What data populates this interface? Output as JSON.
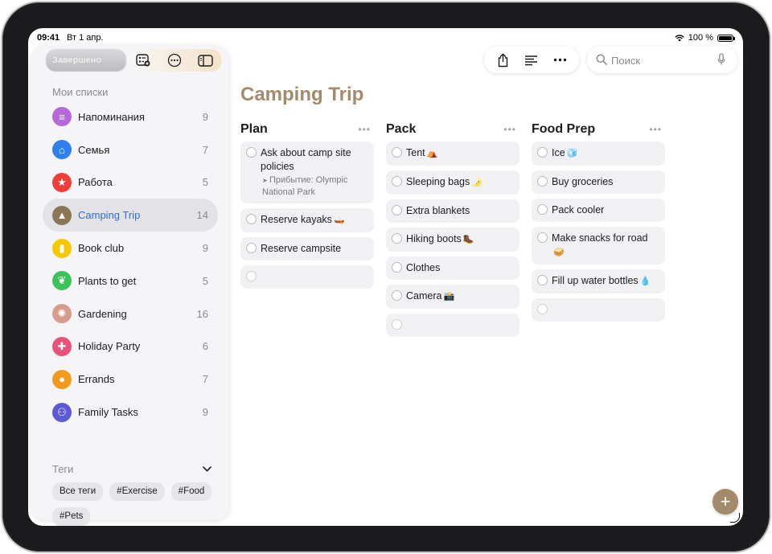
{
  "status": {
    "time": "09:41",
    "date": "Вт 1 апр.",
    "battery": "100 %"
  },
  "sidebar": {
    "top_pill": "Завершено",
    "section_title": "Мои списки",
    "lists": [
      {
        "label": "Напоминания",
        "count": "9",
        "color": "#b36ad6",
        "icon": "list-icon",
        "glyph": "≡"
      },
      {
        "label": "Семья",
        "count": "7",
        "color": "#2f80ed",
        "icon": "house-icon",
        "glyph": "⌂"
      },
      {
        "label": "Работа",
        "count": "5",
        "color": "#ef3e3a",
        "icon": "star-icon",
        "glyph": "★"
      },
      {
        "label": "Camping Trip",
        "count": "14",
        "color": "#8c7656",
        "icon": "tent-icon",
        "glyph": "▲",
        "selected": true
      },
      {
        "label": "Book club",
        "count": "9",
        "color": "#f6c800",
        "icon": "bookmark-icon",
        "glyph": "▮"
      },
      {
        "label": "Plants to get",
        "count": "5",
        "color": "#3cc45a",
        "icon": "leaf-icon",
        "glyph": "❦"
      },
      {
        "label": "Gardening",
        "count": "16",
        "color": "#d79c8e",
        "icon": "sun-icon",
        "glyph": "✺"
      },
      {
        "label": "Holiday Party",
        "count": "6",
        "color": "#e9537a",
        "icon": "gift-icon",
        "glyph": "✚"
      },
      {
        "label": "Errands",
        "count": "7",
        "color": "#f39a1e",
        "icon": "circle-icon",
        "glyph": "●"
      },
      {
        "label": "Family Tasks",
        "count": "9",
        "color": "#5b5bd6",
        "icon": "people-icon",
        "glyph": "⚇"
      }
    ],
    "tags_title": "Теги",
    "tags": [
      "Все теги",
      "#Exercise",
      "#Food",
      "#Pets"
    ]
  },
  "search": {
    "placeholder": "Поиск"
  },
  "page_title": "Camping Trip",
  "accent_color": "#a38a6a",
  "columns": [
    {
      "title": "Plan",
      "items": [
        {
          "text": "Ask about camp site policies",
          "sub": "Прибытие: Olympic National Park"
        },
        {
          "text": "Reserve kayaks",
          "emoji": "🛶"
        },
        {
          "text": "Reserve campsite"
        }
      ]
    },
    {
      "title": "Pack",
      "items": [
        {
          "text": "Tent",
          "emoji": "⛺"
        },
        {
          "text": "Sleeping bags",
          "emoji": "🌛"
        },
        {
          "text": "Extra blankets"
        },
        {
          "text": "Hiking boots",
          "emoji": "🥾"
        },
        {
          "text": "Clothes"
        },
        {
          "text": "Camera",
          "emoji": "📸"
        }
      ]
    },
    {
      "title": "Food Prep",
      "items": [
        {
          "text": "Ice",
          "emoji": "🧊"
        },
        {
          "text": "Buy groceries"
        },
        {
          "text": "Pack cooler"
        },
        {
          "text": "Make snacks for road",
          "emoji": "🥪"
        },
        {
          "text": "Fill up water bottles",
          "emoji": "💧"
        }
      ]
    }
  ]
}
